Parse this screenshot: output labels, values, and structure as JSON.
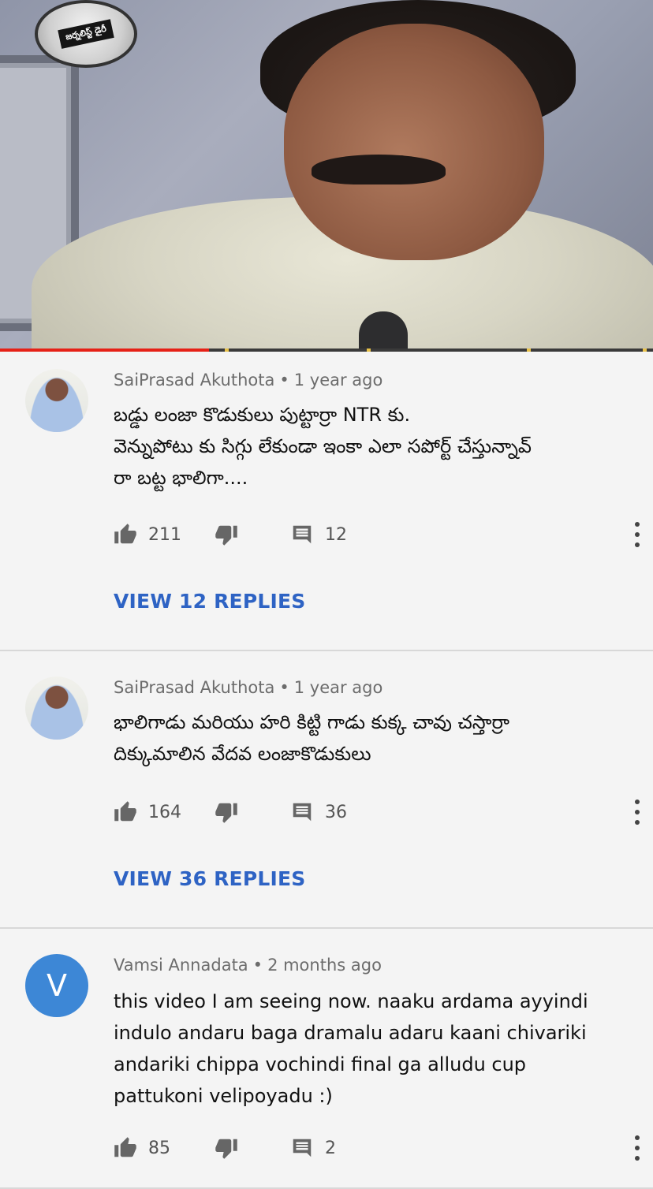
{
  "video": {
    "logo_text": "జర్నలిస్ట్ డైరీ",
    "progress_played": 0.32,
    "accent_color": "#e62117"
  },
  "comments": [
    {
      "author": "SaiPrasad Akuthota",
      "time": "1 year ago",
      "text": "బడ్డు లంజా కొడుకులు పుట్టార్రా NTR కు.\nవెన్నుపోటు కు సిగ్గు లేకుండా ఇంకా ఎలా సపోర్ట్ చేస్తున్నావ్\nరా బట్ట భాలిగా....",
      "likes": "211",
      "replies_count": "12",
      "view_replies": "VIEW 12 REPLIES",
      "avatar": "photo"
    },
    {
      "author": "SaiPrasad Akuthota",
      "time": "1 year ago",
      "text": "భాలిగాడు మరియు హరి కిట్టి గాడు కుక్క చావు చస్తార్రా\nదిక్కుమాలిన వేదవ లంజాకొడుకులు",
      "likes": "164",
      "replies_count": "36",
      "view_replies": "VIEW 36 REPLIES",
      "avatar": "photo"
    },
    {
      "author": "Vamsi Annadata",
      "time": "2 months ago",
      "text": "this video I am seeing now. naaku ardama ayyindi\nindulo andaru baga dramalu adaru kaani chivariki\nandariki chippa vochindi final ga  alludu cup\npattukoni velipoyadu :)",
      "likes": "85",
      "replies_count": "2",
      "avatar_letter": "V",
      "avatar_color": "#3d87d6"
    }
  ],
  "icons": {
    "like": "thumb-up-icon",
    "dislike": "thumb-down-icon",
    "reply": "comment-icon",
    "more": "more-vert-icon"
  }
}
